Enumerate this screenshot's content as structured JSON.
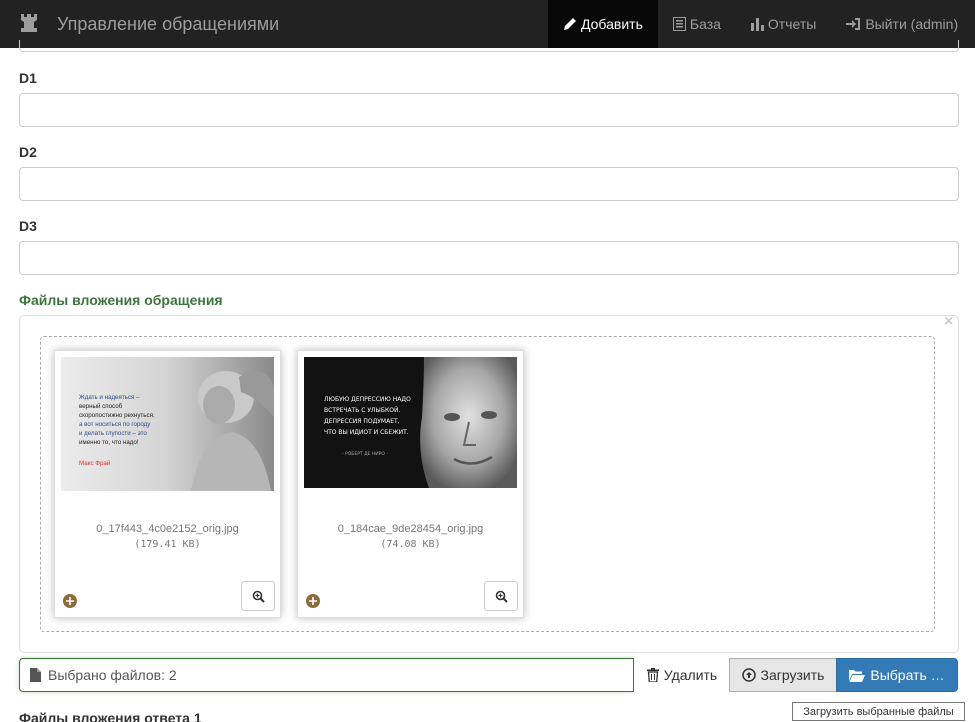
{
  "navbar": {
    "brand": "Управление обращениями",
    "items": [
      {
        "label": "Добавить"
      },
      {
        "label": "База"
      },
      {
        "label": "Отчеты"
      },
      {
        "label": "Выйти (admin)"
      }
    ]
  },
  "form": {
    "fields": [
      {
        "label": "D1",
        "value": ""
      },
      {
        "label": "D2",
        "value": ""
      },
      {
        "label": "D3",
        "value": ""
      }
    ],
    "attachments_label": "Файлы вложения обращения",
    "files": [
      {
        "name": "0_17f443_4c0e2152_orig.jpg",
        "size": "(179.41 KB)",
        "quote_lines": [
          "Ждать и надеяться –",
          "верный способ",
          "скоропостижно рехнуться,",
          "а вот носиться по городу",
          "и делать глупости – это",
          "именно то, что надо!"
        ],
        "quote_author": "Макс Фрай"
      },
      {
        "name": "0_184cae_9de28454_orig.jpg",
        "size": "(74.08 KB)",
        "quote_lines": [
          "ЛЮБУЮ ДЕПРЕССИЮ НАДО",
          "ВСТРЕЧАТЬ С УЛЫБКОЙ.",
          "ДЕПРЕССИЯ ПОДУМАЕТ,",
          "ЧТО ВЫ ИДИОТ И СБЕЖИТ."
        ],
        "quote_author": "- РОБЕРТ ДЕ НИРО -"
      }
    ],
    "caption": "Выбрано файлов: 2",
    "remove_label": "Удалить",
    "upload_label": "Загрузить",
    "browse_label": "Выбрать …",
    "reply_attachments_label": "Файлы вложения ответа 1",
    "tooltip": "Загрузить выбранные файлы"
  },
  "colors": {
    "navbar_bg": "#222222",
    "success": "#3c763d",
    "primary": "#337ab7"
  },
  "icons": [
    "rook-icon",
    "pencil-icon",
    "list-icon",
    "bar-chart-icon",
    "log-in-icon",
    "close-icon",
    "zoom-in-icon",
    "move-icon",
    "file-icon",
    "trash-icon",
    "upload-icon",
    "folder-open-icon"
  ]
}
